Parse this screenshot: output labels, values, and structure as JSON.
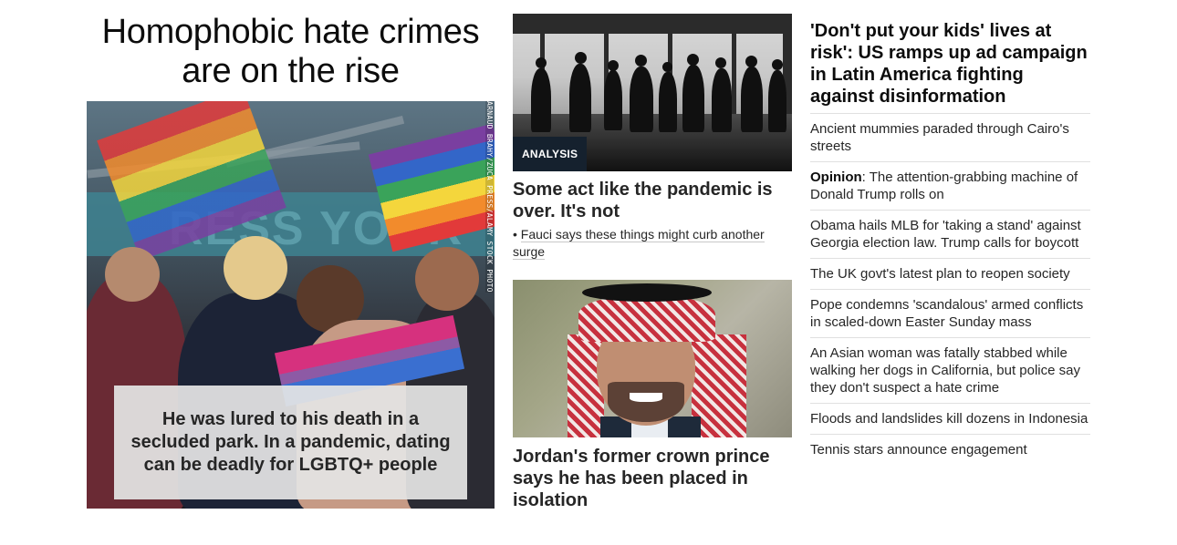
{
  "lead": {
    "headline": "Homophobic hate crimes are on the rise",
    "image_credit": "ARNAUD BRAHY/ZUCA PRESS/ALAMY STOCK PHOTO",
    "caption": "He was lured to his death in a secluded park. In a pandemic, dating can be deadly for LGBTQ+ people"
  },
  "middle": {
    "story1": {
      "badge": "ANALYSIS",
      "title": "Some act like the pandemic is over. It's not",
      "related_bullet": "•",
      "related": "Fauci says these things might curb another surge"
    },
    "story2": {
      "title": "Jordan's former crown prince says he has been placed in isolation"
    }
  },
  "right": {
    "headline": "'Don't put your kids' lives at risk': US ramps up ad campaign in Latin America fighting against disinformation",
    "items": [
      {
        "prefix": "",
        "text": "Ancient mummies paraded through Cairo's streets"
      },
      {
        "prefix": "Opinion",
        "text": ": The attention-grabbing machine of Donald Trump rolls on"
      },
      {
        "prefix": "",
        "text": "Obama hails MLB for 'taking a stand' against Georgia election law. Trump calls for boycott"
      },
      {
        "prefix": "",
        "text": "The UK govt's latest plan to reopen society"
      },
      {
        "prefix": "",
        "text": "Pope condemns 'scandalous' armed conflicts in scaled-down Easter Sunday mass"
      },
      {
        "prefix": "",
        "text": "An Asian woman was fatally stabbed while walking her dogs in California, but police say they don't suspect a hate crime"
      },
      {
        "prefix": "",
        "text": "Floods and landslides kill dozens in Indonesia"
      },
      {
        "prefix": "",
        "text": "Tennis stars announce engagement"
      }
    ]
  }
}
